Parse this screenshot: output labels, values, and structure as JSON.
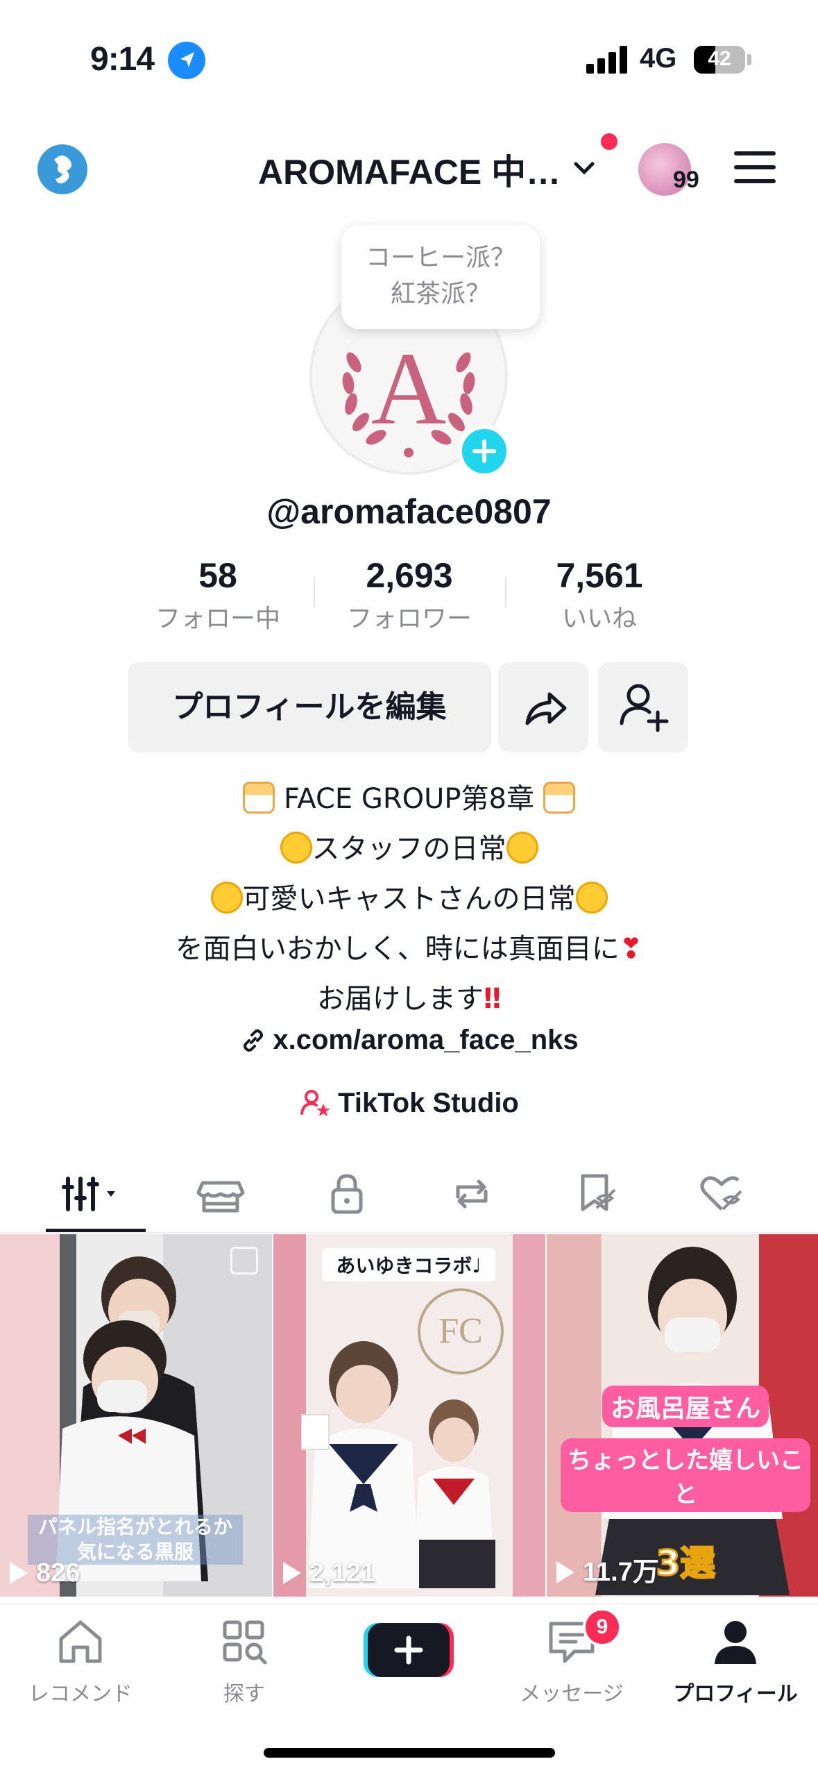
{
  "status_bar": {
    "time": "9:14",
    "network": "4G",
    "battery": "42"
  },
  "header": {
    "title": "AROMAFACE 中…",
    "avatar_count": "99"
  },
  "profile": {
    "tooltip_line1": "コーヒー派？",
    "tooltip_line2": "紅茶派？",
    "handle": "@aromaface0807",
    "stats": [
      {
        "value": "58",
        "label": "フォロー中"
      },
      {
        "value": "2,693",
        "label": "フォロワー"
      },
      {
        "value": "7,561",
        "label": "いいね"
      }
    ],
    "edit_button": "プロフィールを編集",
    "bio": {
      "line1": "FACE GROUP第8章",
      "line2": "スタッフの日常",
      "line3": "可愛いキャストさんの日常",
      "line4": "を面白いおかしく、時には真面目に",
      "line5": "お届けします"
    },
    "link": "x.com/aroma_face_nks",
    "studio": "TikTok Studio"
  },
  "videos": [
    {
      "views": "826",
      "caption": "パネル指名がとれるか\n気になる黒服"
    },
    {
      "views": "2,121",
      "caption": "あいゆきコラボ♩"
    },
    {
      "views": "11.7万",
      "caption_line1": "お風呂屋さん",
      "caption_line2": "ちょっとした嬉しいこと",
      "caption_line3": "3選"
    }
  ],
  "bottom_nav": {
    "home": "レコメンド",
    "discover": "探す",
    "messages": "メッセージ",
    "message_badge": "9",
    "profile": "プロフィール"
  },
  "colors": {
    "accent": "#fe2c55",
    "cyan": "#20d5ec",
    "link_blue": "#1a8cff"
  }
}
